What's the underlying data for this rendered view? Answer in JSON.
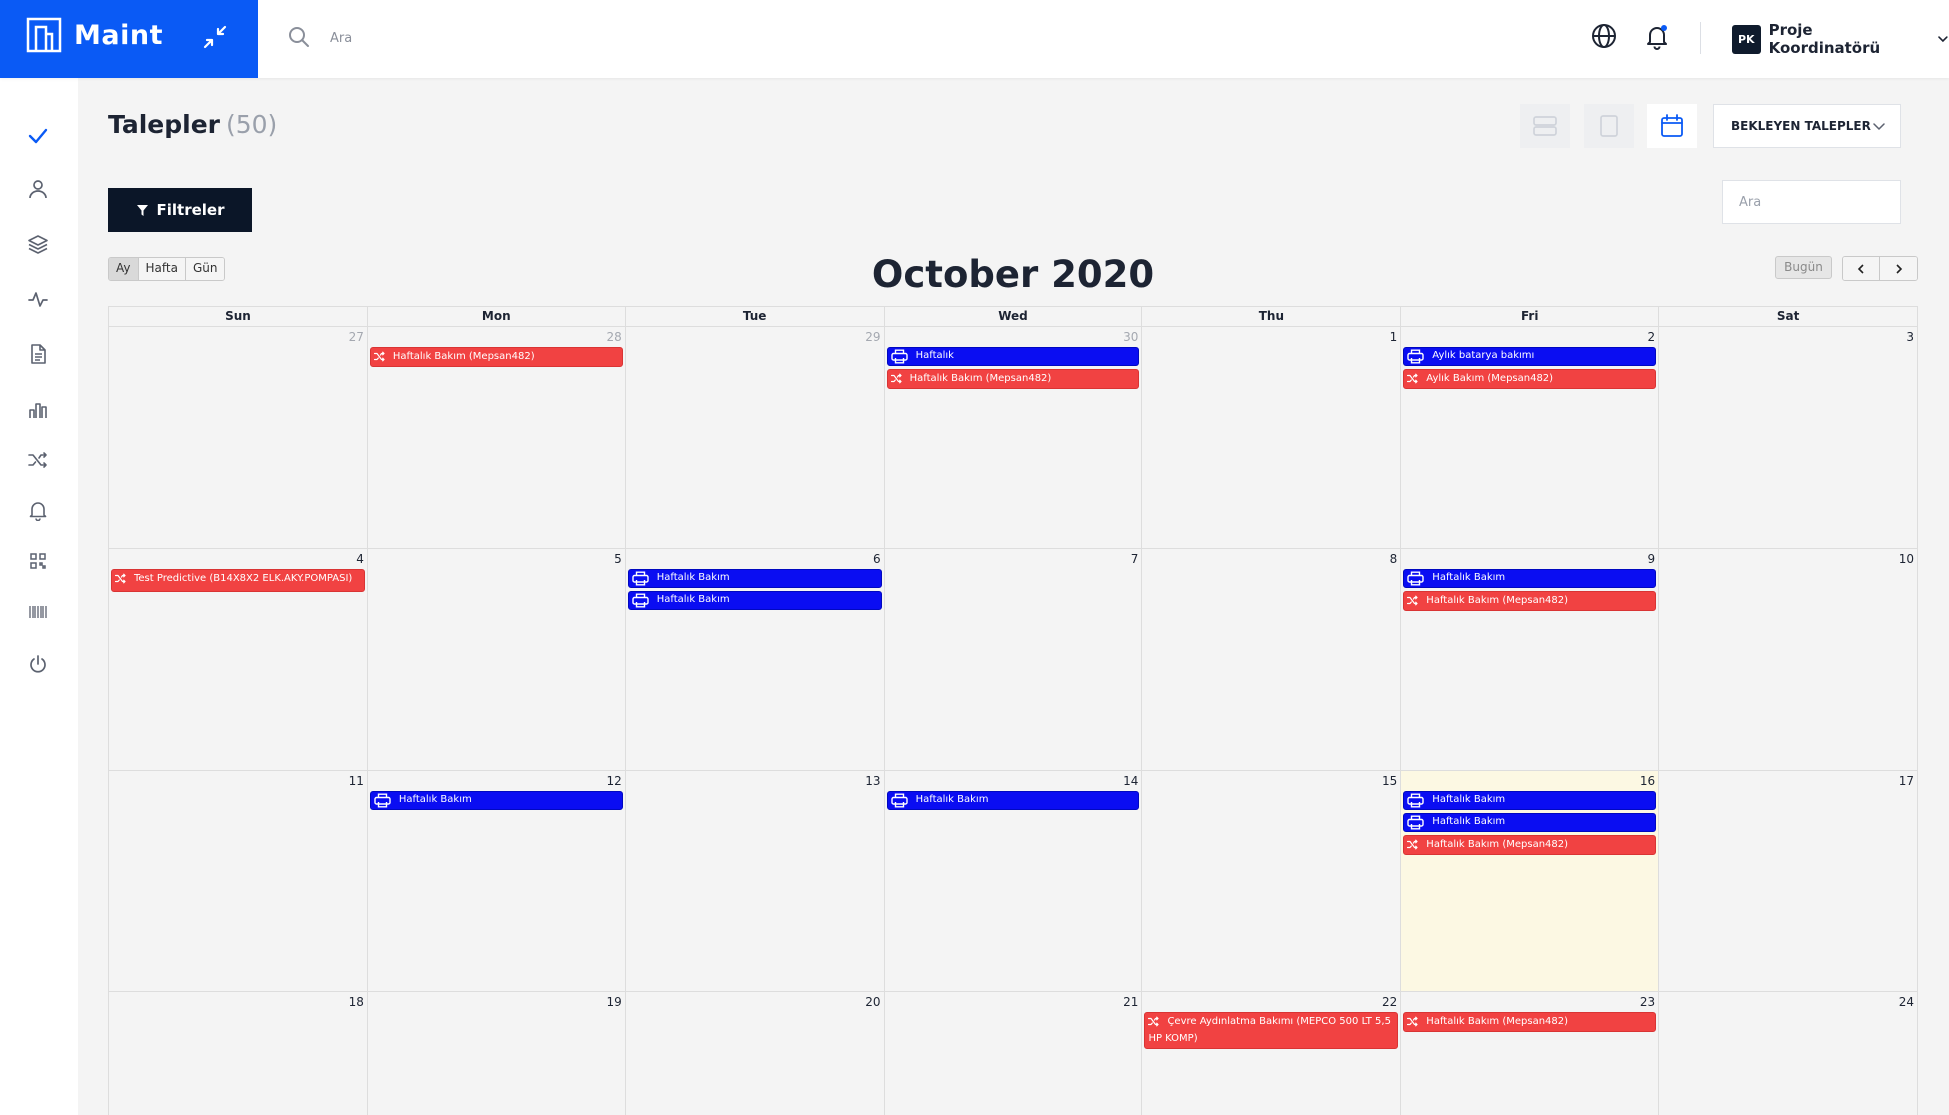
{
  "app": {
    "name": "Maint"
  },
  "search": {
    "placeholder": "Ara"
  },
  "user": {
    "initials": "PK",
    "name": "Proje Koordinatörü"
  },
  "page": {
    "title": "Talepler",
    "count": "(50)"
  },
  "status_filter": {
    "selected": "BEKLEYEN TALEPLER"
  },
  "filters_button": "Filtreler",
  "calendar_search": {
    "placeholder": "Ara"
  },
  "calendar": {
    "title": "October 2020",
    "views": [
      "Ay",
      "Hafta",
      "Gün"
    ],
    "active_view": "Ay",
    "today_label": "Bugün",
    "weekdays": [
      "Sun",
      "Mon",
      "Tue",
      "Wed",
      "Thu",
      "Fri",
      "Sat"
    ],
    "weeks": [
      [
        {
          "day": "27",
          "other": true,
          "events": []
        },
        {
          "day": "28",
          "other": true,
          "events": [
            {
              "title": "Haftalık Bakım (Mepsan482)",
              "type": "red"
            }
          ]
        },
        {
          "day": "29",
          "other": true,
          "events": []
        },
        {
          "day": "30",
          "other": true,
          "events": [
            {
              "title": "Haftalık",
              "type": "blue"
            },
            {
              "title": "Haftalık Bakım (Mepsan482)",
              "type": "red"
            }
          ]
        },
        {
          "day": "1",
          "events": []
        },
        {
          "day": "2",
          "events": [
            {
              "title": "Aylık batarya bakımı",
              "type": "blue"
            },
            {
              "title": "Aylık Bakım (Mepsan482)",
              "type": "red"
            }
          ]
        },
        {
          "day": "3",
          "events": []
        }
      ],
      [
        {
          "day": "4",
          "events": [
            {
              "title": "Test Predictive (B14X8X2 ELK.AKY.POMPASI)",
              "type": "red",
              "wrap": true
            }
          ]
        },
        {
          "day": "5",
          "events": []
        },
        {
          "day": "6",
          "events": [
            {
              "title": "Haftalık Bakım",
              "type": "blue"
            },
            {
              "title": "Haftalık Bakım",
              "type": "blue"
            }
          ]
        },
        {
          "day": "7",
          "events": []
        },
        {
          "day": "8",
          "events": []
        },
        {
          "day": "9",
          "events": [
            {
              "title": "Haftalık Bakım",
              "type": "blue"
            },
            {
              "title": "Haftalık Bakım (Mepsan482)",
              "type": "red"
            }
          ]
        },
        {
          "day": "10",
          "events": []
        }
      ],
      [
        {
          "day": "11",
          "events": []
        },
        {
          "day": "12",
          "events": [
            {
              "title": "Haftalık Bakım",
              "type": "blue"
            }
          ]
        },
        {
          "day": "13",
          "events": []
        },
        {
          "day": "14",
          "events": [
            {
              "title": "Haftalık Bakım",
              "type": "blue"
            }
          ]
        },
        {
          "day": "15",
          "events": []
        },
        {
          "day": "16",
          "today": true,
          "events": [
            {
              "title": "Haftalık Bakım",
              "type": "blue"
            },
            {
              "title": "Haftalık Bakım",
              "type": "blue"
            },
            {
              "title": "Haftalık Bakım (Mepsan482)",
              "type": "red"
            }
          ]
        },
        {
          "day": "17",
          "events": []
        }
      ],
      [
        {
          "day": "18",
          "events": []
        },
        {
          "day": "19",
          "events": []
        },
        {
          "day": "20",
          "events": []
        },
        {
          "day": "21",
          "events": []
        },
        {
          "day": "22",
          "events": [
            {
              "title": "Çevre Aydınlatma Bakımı (MEPCO 500 LT 5,5 HP KOMP)",
              "type": "red",
              "wrap": true
            }
          ]
        },
        {
          "day": "23",
          "events": [
            {
              "title": "Haftalık Bakım (Mepsan482)",
              "type": "red"
            }
          ]
        },
        {
          "day": "24",
          "events": []
        }
      ]
    ]
  },
  "colors": {
    "brand": "#0a5af5",
    "event_blue": "#0a0df2",
    "event_red": "#f14242",
    "today": "#fcf8e3",
    "dark": "#0b1628"
  },
  "sidebar_icons": [
    "check-icon",
    "user-icon",
    "layers-icon",
    "activity-icon",
    "document-icon",
    "bar-chart-icon",
    "shuffle-icon",
    "bell-icon",
    "qr-code-icon",
    "barcode-icon",
    "power-icon"
  ]
}
